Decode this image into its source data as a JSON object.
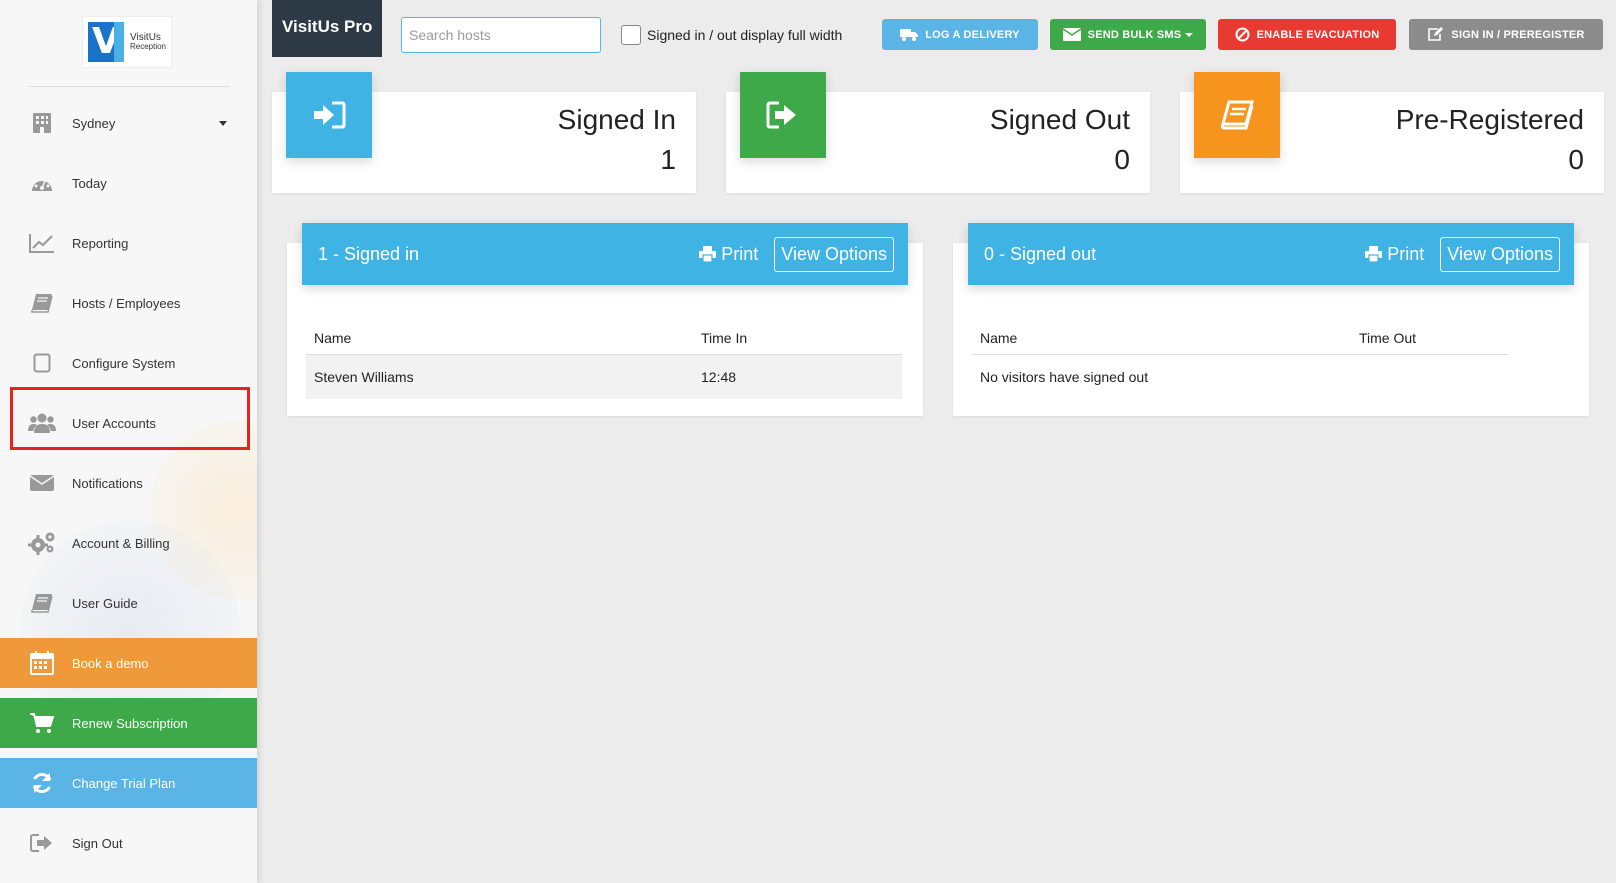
{
  "brand": {
    "logo_title": "VisitUs",
    "logo_subtitle": "Reception",
    "logo_letter": "V",
    "app_name": "VisitUs Pro"
  },
  "sidebar": {
    "items": [
      {
        "label": "Sydney",
        "icon": "building-icon"
      },
      {
        "label": "Today",
        "icon": "dashboard-icon"
      },
      {
        "label": "Reporting",
        "icon": "chart-line-icon"
      },
      {
        "label": "Hosts / Employees",
        "icon": "book-icon"
      },
      {
        "label": "Configure System",
        "icon": "tablet-icon"
      },
      {
        "label": "User Accounts",
        "icon": "users-icon"
      },
      {
        "label": "Notifications",
        "icon": "envelope-icon"
      },
      {
        "label": "Account & Billing",
        "icon": "gears-icon"
      },
      {
        "label": "User Guide",
        "icon": "book-icon"
      },
      {
        "label": "Book a demo",
        "icon": "calendar-icon"
      },
      {
        "label": "Renew Subscription",
        "icon": "cart-icon"
      },
      {
        "label": "Change Trial Plan",
        "icon": "refresh-icon"
      },
      {
        "label": "Sign Out",
        "icon": "sign-out-icon"
      }
    ]
  },
  "topbar": {
    "search_placeholder": "Search hosts",
    "fullwidth_label": "Signed in / out display full width",
    "buttons": {
      "delivery": "LOG A DELIVERY",
      "sms": "SEND BULK SMS",
      "evacuation": "ENABLE EVACUATION",
      "signin": "SIGN IN / PREREGISTER"
    }
  },
  "stats": [
    {
      "title": "Signed In",
      "value": "1",
      "color": "#3fb4e4",
      "icon": "sign-in-icon"
    },
    {
      "title": "Signed Out",
      "value": "0",
      "color": "#3ea949",
      "icon": "sign-out-icon"
    },
    {
      "title": "Pre-Registered",
      "value": "0",
      "color": "#f7941d",
      "icon": "book-icon"
    }
  ],
  "panels": {
    "signed_in": {
      "title": "1 - Signed in",
      "print": "Print",
      "view_options": "View Options",
      "columns": [
        "Name",
        "Time In"
      ],
      "rows": [
        [
          "Steven Williams",
          "12:48"
        ]
      ]
    },
    "signed_out": {
      "title": "0 - Signed out",
      "print": "Print",
      "view_options": "View Options",
      "columns": [
        "Name",
        "Time Out"
      ],
      "empty": "No visitors have signed out"
    }
  },
  "colors": {
    "accent_blue": "#3fb4e4",
    "green": "#3ea949",
    "orange": "#f0993a",
    "red": "#e83a30",
    "grey": "#8c8c8c",
    "highlight": "#e8231c"
  }
}
